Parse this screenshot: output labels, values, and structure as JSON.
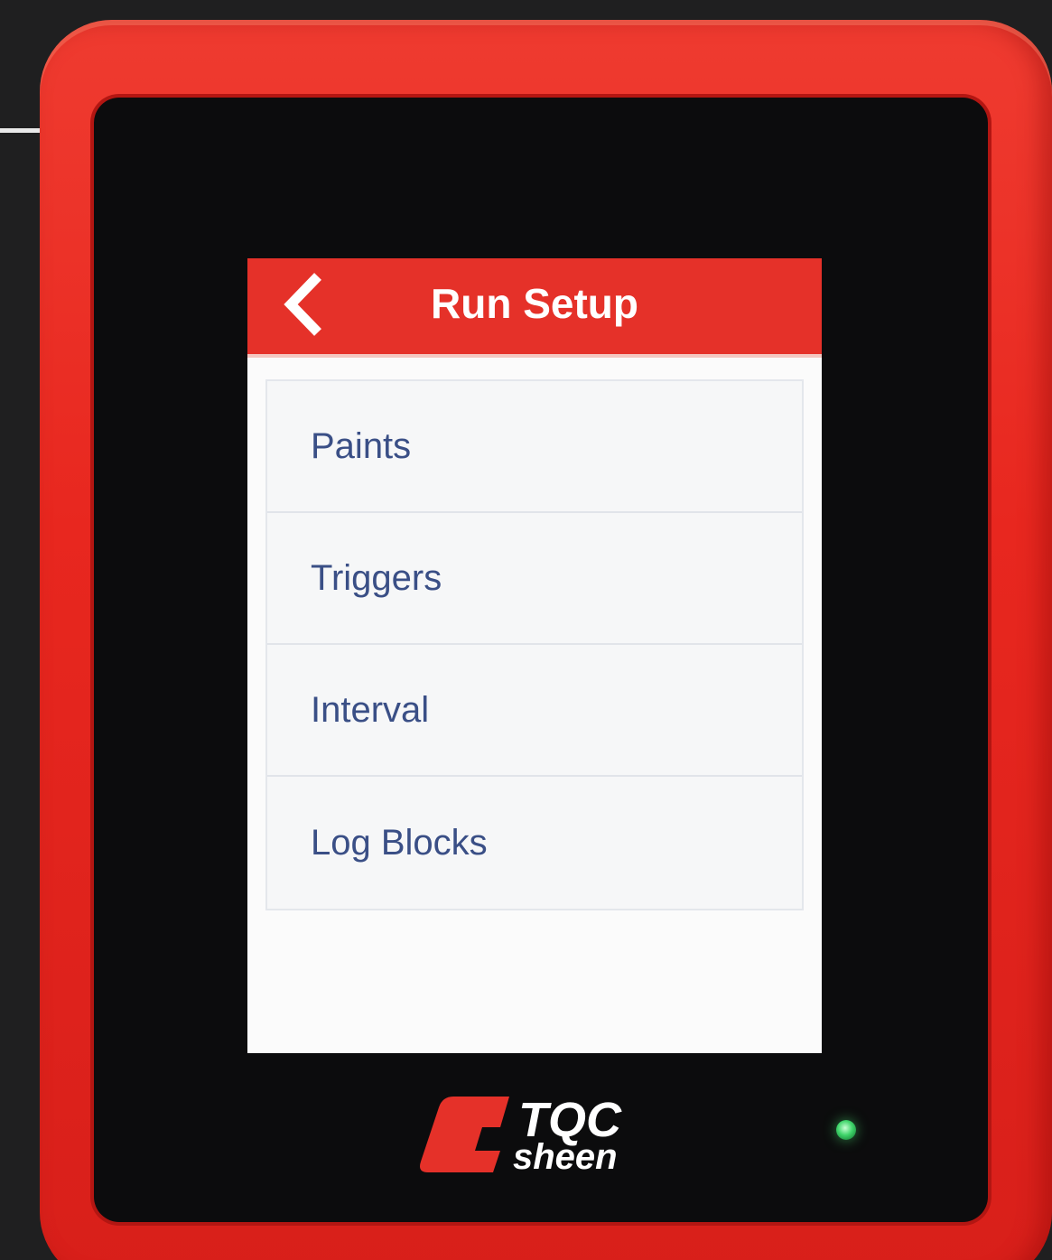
{
  "device": {
    "brand_logo": {
      "line1": "TQC",
      "line2": "sheen"
    },
    "status_led_color": "#3fd46a"
  },
  "screen": {
    "header": {
      "title": "Run Setup",
      "back_icon": "chevron-left-icon"
    },
    "menu": {
      "items": [
        {
          "label": "Paints"
        },
        {
          "label": "Triggers"
        },
        {
          "label": "Interval"
        },
        {
          "label": "Log Blocks"
        }
      ]
    }
  },
  "colors": {
    "accent": "#e53129",
    "menu_text": "#3a4f86"
  }
}
